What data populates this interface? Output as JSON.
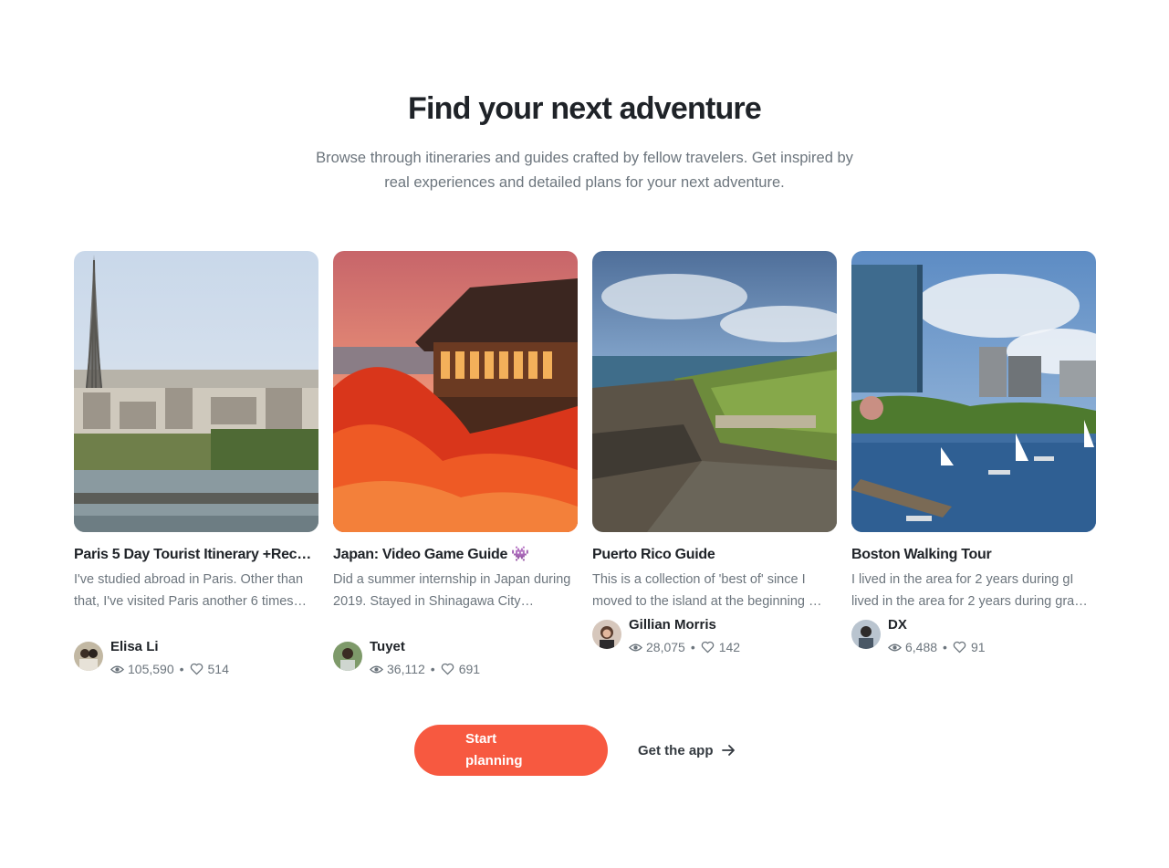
{
  "hero": {
    "title": "Find your next adventure",
    "subtitle": "Browse through itineraries and guides crafted by fellow travelers. Get inspired by real experiences and detailed plans for your next adventure."
  },
  "guides": [
    {
      "title": "Paris 5 Day Tourist Itinerary +Rec…",
      "description": "I've studied abroad in Paris. Other than that, I've visited Paris another 6 times…",
      "author": "Elisa Li",
      "views": "105,590",
      "likes": "514"
    },
    {
      "title": "Japan: Video Game Guide",
      "title_emoji": "👾",
      "description": "Did a summer internship in Japan during 2019. Stayed in Shinagawa City…",
      "author": "Tuyet",
      "views": "36,112",
      "likes": "691"
    },
    {
      "title": "Puerto Rico Guide",
      "description": "This is a collection of 'best of' since I moved to the island at the beginning …",
      "author": "Gillian Morris",
      "views": "28,075",
      "likes": "142"
    },
    {
      "title": "Boston Walking Tour",
      "description": "I lived in the area for 2 years during gI lived in the area for 2 years during gra…",
      "author": "DX",
      "views": "6,488",
      "likes": "91"
    }
  ],
  "stat_separator": "•",
  "actions": {
    "start_planning": "Start planning",
    "get_app": "Get the app"
  },
  "colors": {
    "accent": "#f75940",
    "heading": "#1f2328",
    "muted": "#6c757d"
  },
  "icons": {
    "views": "eye-icon",
    "likes": "heart-icon",
    "arrow": "arrow-right-icon"
  }
}
